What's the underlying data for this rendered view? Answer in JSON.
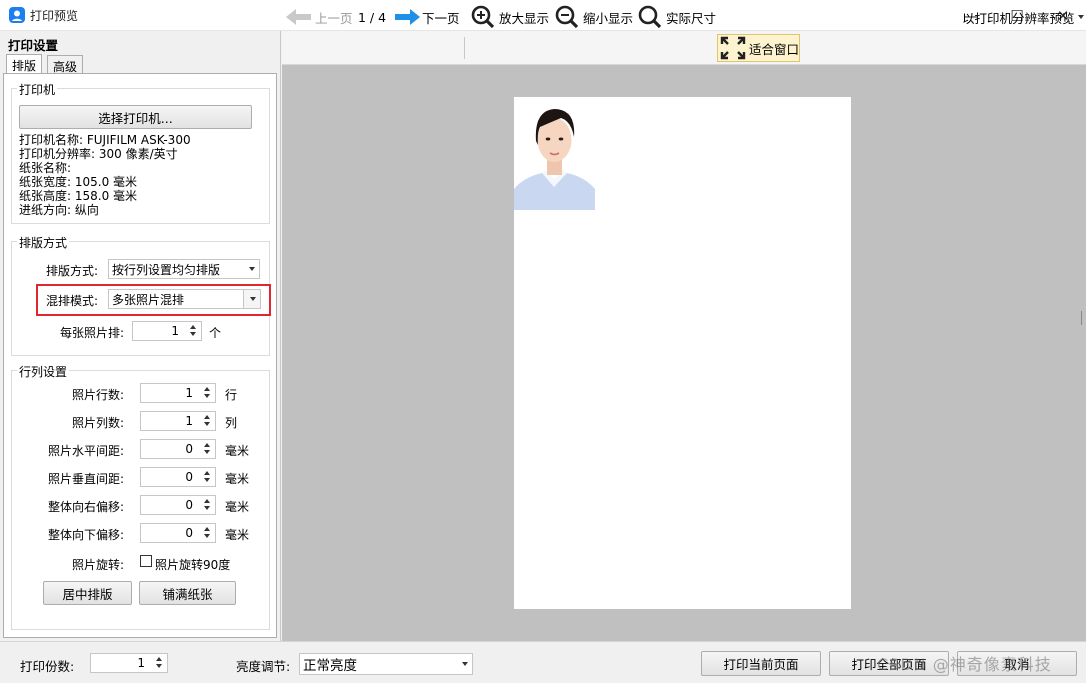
{
  "window": {
    "title": "打印预览",
    "minimize": "—",
    "maximize": "☐",
    "close": "✕"
  },
  "left_panel": {
    "title": "打印设置",
    "tabs": [
      "排版",
      "高级"
    ],
    "printer_group": {
      "title": "打印机",
      "select_button": "选择打印机...",
      "info": [
        "打印机名称: FUJIFILM ASK-300",
        "打印机分辨率: 300 像素/英寸",
        "纸张名称:",
        "纸张宽度: 105.0 毫米",
        "纸张高度: 158.0 毫米",
        "进纸方向: 纵向"
      ]
    },
    "layout_group": {
      "title": "排版方式",
      "layout_label": "排版方式:",
      "layout_value": "按行列设置均匀排版",
      "mix_label": "混排模式:",
      "mix_value": "多张照片混排",
      "per_label": "每张照片排:",
      "per_value": "1",
      "per_unit": "个"
    },
    "grid_group": {
      "title": "行列设置",
      "rows": [
        {
          "label": "照片行数:",
          "value": "1",
          "unit": "行"
        },
        {
          "label": "照片列数:",
          "value": "1",
          "unit": "列"
        },
        {
          "label": "照片水平间距:",
          "value": "0",
          "unit": "毫米"
        },
        {
          "label": "照片垂直间距:",
          "value": "0",
          "unit": "毫米"
        },
        {
          "label": "整体向右偏移:",
          "value": "0",
          "unit": "毫米"
        },
        {
          "label": "整体向下偏移:",
          "value": "0",
          "unit": "毫米"
        }
      ],
      "rotate_label": "照片旋转:",
      "rotate_checkbox": "照片旋转90度",
      "center_button": "居中排版",
      "fill_button": "铺满纸张"
    }
  },
  "toolbar": {
    "prev": "上一页",
    "page": "1 / 4",
    "next": "下一页",
    "zoom_in": "放大显示",
    "zoom_out": "缩小显示",
    "actual": "实际尺寸",
    "fit": "适合窗口",
    "preview_mode": "以打印机分辨率预览"
  },
  "bottom": {
    "copies_label": "打印份数:",
    "copies_value": "1",
    "brightness_label": "亮度调节:",
    "brightness_value": "正常亮度",
    "print_current": "打印当前页面",
    "print_all": "打印全部页面",
    "cancel": "取消",
    "watermark": "CSDN @神奇像素科技"
  },
  "colors": {
    "accent": "#1a7ff0",
    "highlight": "#e0262e"
  }
}
